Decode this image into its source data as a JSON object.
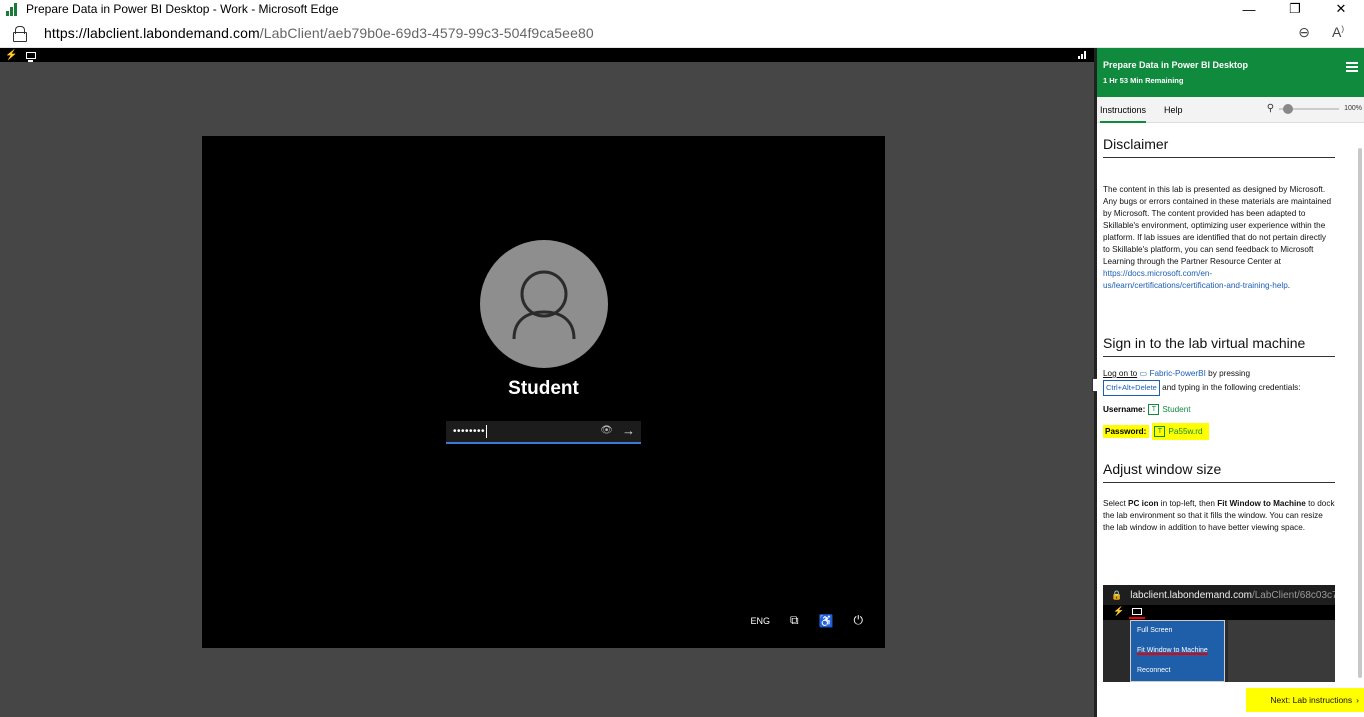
{
  "window": {
    "title": "Prepare Data in Power BI Desktop - Work - Microsoft Edge",
    "minimize": "—",
    "maximize": "❐",
    "close": "✕"
  },
  "address_bar": {
    "url_host": "https://labclient.labondemand.com",
    "url_path": "/LabClient/aeb79b0e-69d3-4579-99c3-504f9ca5ee80",
    "zoom_icon": "zoom-out-icon",
    "read_aloud_icon": "read-aloud-icon"
  },
  "vm": {
    "username": "Student",
    "password_mask": "••••••••",
    "language": "ENG",
    "icons": [
      "network-icon",
      "accessibility-icon",
      "power-icon"
    ]
  },
  "panel": {
    "title": "Prepare Data in Power BI Desktop",
    "time_remaining": "1 Hr 53 Min Remaining",
    "tabs": [
      "Instructions",
      "Help"
    ],
    "zoom_level": "100%",
    "disclaimer": {
      "heading": "Disclaimer",
      "body": "The content in this lab is presented as designed by Microsoft. Any bugs or errors contained in these materials are maintained by Microsoft. The content provided has been adapted to Skillable's environment, optimizing user experience within the platform. If lab issues are identified that do not pertain directly to Skillable's platform, you can send feedback to Microsoft Learning through the Partner Resource Center at ",
      "link": "https://docs.microsoft.com/en-us/learn/certifications/certification-and-training-help",
      "end": "."
    },
    "signin": {
      "heading": "Sign in to the lab virtual machine",
      "log_on_to": "Log on to",
      "machine": "Fabric-PowerBI",
      "by_pressing": "by pressing",
      "keys": "Ctrl+Alt+Delete",
      "typing": "and typing in the following credentials:",
      "username_label": "Username:",
      "username_value": "Student",
      "password_label": "Password:",
      "password_value": "Pa55w.rd",
      "type_glyph": "T"
    },
    "adjust": {
      "heading": "Adjust window size",
      "select": "Select ",
      "pc_icon": "PC icon",
      "mid": " in top-left, then ",
      "fit": "Fit Window to Machine",
      "rest": " to dock the lab environment so that it fills the window. You can resize the lab window in addition to have better viewing space."
    },
    "thumbnail": {
      "url_host": "labclient.labondemand.com",
      "url_path": "/LabClient/68c03c7",
      "menu_items": [
        "Full Screen",
        "Fit Window to Machine",
        "Reconnect"
      ]
    },
    "next_button": "Next: Lab instructions"
  }
}
